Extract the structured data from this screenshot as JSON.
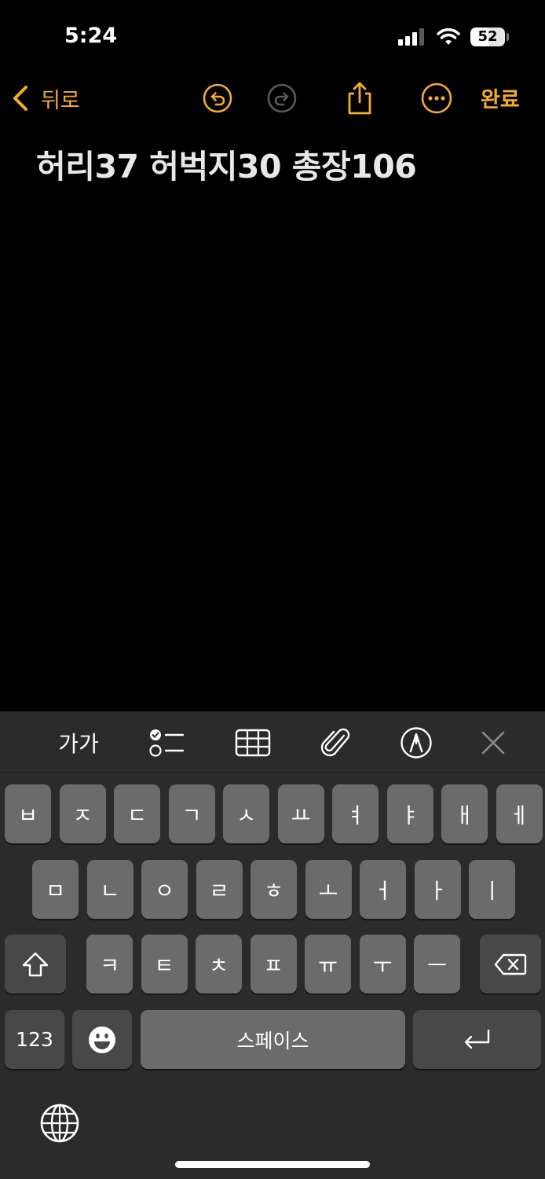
{
  "status": {
    "time": "5:24",
    "battery": "52",
    "battery_level": 0.52
  },
  "nav": {
    "back_label": "뒤로",
    "done_label": "완료"
  },
  "note": {
    "text": "허리37 허벅지30 총장106"
  },
  "toolbar": {
    "format_label": "가가"
  },
  "keyboard": {
    "row1": [
      "ㅂ",
      "ㅈ",
      "ㄷ",
      "ㄱ",
      "ㅅ",
      "ㅛ",
      "ㅕ",
      "ㅑ",
      "ㅐ",
      "ㅔ"
    ],
    "row2": [
      "ㅁ",
      "ㄴ",
      "ㅇ",
      "ㄹ",
      "ㅎ",
      "ㅗ",
      "ㅓ",
      "ㅏ",
      "ㅣ"
    ],
    "row3": [
      "ㅋ",
      "ㅌ",
      "ㅊ",
      "ㅍ",
      "ㅠ",
      "ㅜ",
      "ㅡ"
    ],
    "numbers_label": "123",
    "space_label": "스페이스"
  },
  "colors": {
    "accent": "#f5ad2b",
    "key": "#6b6b6b",
    "key_dark": "#484848",
    "keyboard_bg": "#2b2b2b"
  }
}
